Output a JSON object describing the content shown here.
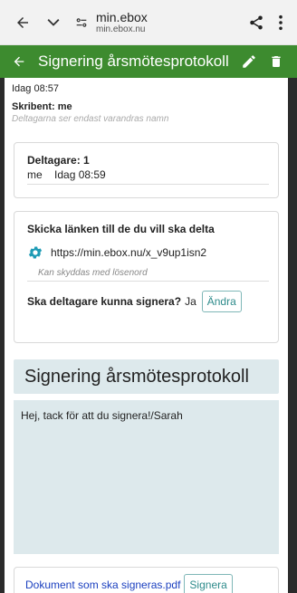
{
  "browser": {
    "site_title": "min.ebox",
    "site_url": "min.ebox.nu"
  },
  "header": {
    "title": "Signering årsmötesprotokoll"
  },
  "meta": {
    "time": "Idag 08:57",
    "writer_label": "Skribent:",
    "writer_name": "me",
    "hint": "Deltagarna ser endast varandras namn"
  },
  "participants": {
    "title": "Deltagare: 1",
    "rows": [
      {
        "name": "me",
        "time": "Idag 08:59"
      }
    ]
  },
  "share": {
    "title": "Skicka länken till de du vill ska delta",
    "link": "https://min.ebox.nu/x_v9up1isn2",
    "password_placeholder": "Kan skyddas med lösenord",
    "sign_question": "Ska deltagare kunna signera?",
    "sign_answer": "Ja",
    "change_button": "Ändra"
  },
  "document": {
    "title": "Signering årsmötesprotokoll",
    "message": "Hej, tack för att du signera!/Sarah",
    "file_name": "Dokument som ska signeras.pdf",
    "sign_button": "Signera"
  },
  "colors": {
    "header_green": "#3d8b2f",
    "panel_blue": "#dde9ec",
    "button_teal": "#2e8b8b",
    "link_blue": "#1a3fbf",
    "gear_teal": "#1e9bb5"
  },
  "icons": {
    "back": "back-arrow-icon",
    "expand": "chevron-down-icon",
    "site_settings": "site-settings-icon",
    "share": "share-icon",
    "menu": "more-vertical-icon",
    "edit": "pencil-icon",
    "delete": "trash-icon",
    "gear": "gear-icon"
  }
}
